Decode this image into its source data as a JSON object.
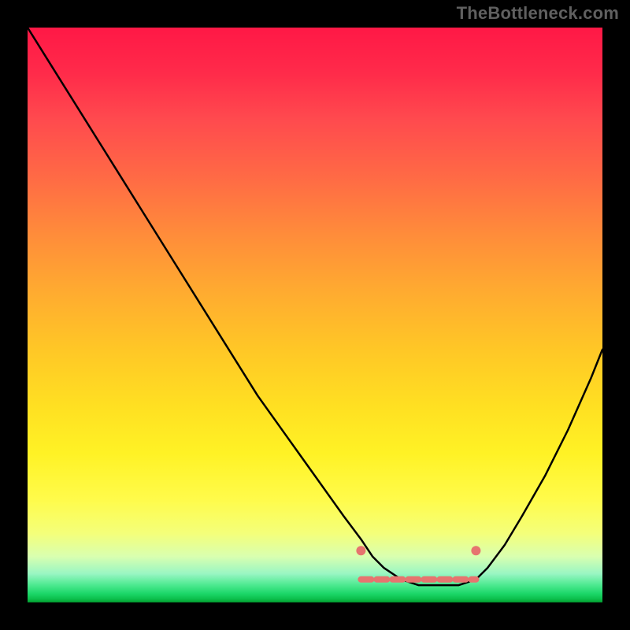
{
  "watermark": "TheBottleneck.com",
  "colors": {
    "background": "#000000",
    "curve": "#000000",
    "markers": "#e6746f"
  },
  "chart_data": {
    "type": "line",
    "title": "",
    "xlabel": "",
    "ylabel": "",
    "xlim": [
      0,
      100
    ],
    "ylim": [
      0,
      100
    ],
    "series": [
      {
        "name": "bottleneck-curve",
        "x": [
          0,
          5,
          10,
          15,
          20,
          25,
          30,
          35,
          40,
          45,
          50,
          55,
          58,
          60,
          62,
          65,
          68,
          70,
          72,
          75,
          78,
          80,
          83,
          86,
          90,
          94,
          98,
          100
        ],
        "values": [
          100,
          92,
          84,
          76,
          68,
          60,
          52,
          44,
          36,
          29,
          22,
          15,
          11,
          8,
          6,
          4,
          3,
          3,
          3,
          3,
          4,
          6,
          10,
          15,
          22,
          30,
          39,
          44
        ]
      }
    ],
    "optimal_range": {
      "x_start": 58,
      "x_end": 78,
      "y": 4
    },
    "markers": [
      {
        "x": 58,
        "y": 9
      },
      {
        "x": 78,
        "y": 9
      }
    ],
    "gradient_stops": [
      {
        "pos": 0.0,
        "color": "#ff1846"
      },
      {
        "pos": 0.5,
        "color": "#ffc726"
      },
      {
        "pos": 0.82,
        "color": "#fffb4a"
      },
      {
        "pos": 0.95,
        "color": "#99f6c3"
      },
      {
        "pos": 1.0,
        "color": "#029b2e"
      }
    ]
  }
}
